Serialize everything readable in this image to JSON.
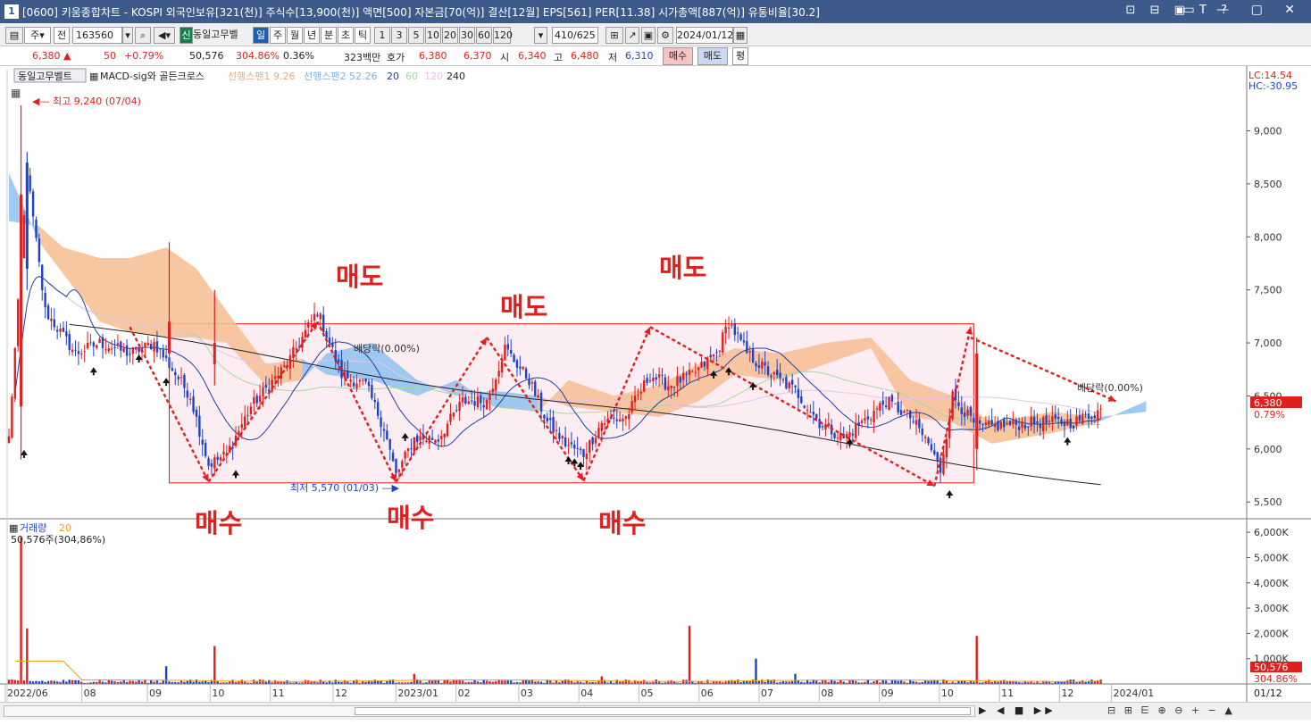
{
  "window": {
    "icon": "1",
    "title": "[0600] 키움종합차트 - KOSPI 외국인보유[321(천)] 주식수[13,900(천)] 액면[500] 자본금[70(억)] 결산[12월] EPS[561] PER[11.38] 시가총액[887(억)] 유통비율[30.2]",
    "tools": "⊡ ⊟ ▣ T ?",
    "controls": "▭ — ▢ ✕"
  },
  "toolbar": {
    "period_main": "주",
    "prev": "전",
    "code": "163560",
    "badge": "신",
    "name": "동일고무벨",
    "periods": [
      "일",
      "주",
      "월",
      "년",
      "분",
      "초",
      "틱"
    ],
    "minutes": [
      "1",
      "3",
      "5",
      "10",
      "20",
      "30",
      "60",
      "120"
    ],
    "count": "410",
    "count_total": "/625",
    "date": "2024/01/12"
  },
  "quote": {
    "price": "6,380",
    "arrow": "▲",
    "change": "50",
    "rate": "+0.79%",
    "volume": "50,576",
    "vol_ratio": "304.86%",
    "turnover": "0.36%",
    "amount": "323백만",
    "hoga_label": "호가",
    "ask": "6,380",
    "bid": "6,370",
    "open_label": "시",
    "open": "6,340",
    "high_label": "고",
    "high": "6,480",
    "low_label": "저",
    "low": "6,310",
    "buy_btn": "매수",
    "sell_btn": "매도",
    "eval_btn": "평"
  },
  "legend": {
    "name": "동일고무벨트",
    "indicator": "MACD-sig와 골든크로스",
    "span1": "선행스팬1 9.26",
    "span2": "선행스팬2 52.26",
    "ma20": "20",
    "ma60": "60",
    "ma120": "120",
    "ma240": "240",
    "lc": "LC:14.54",
    "hc": "HC:-30.95"
  },
  "annotations": {
    "high_mark": "최고 9,240 (07/04)",
    "low_mark": "최저 5,570 (01/03)",
    "dividend1": "배당락(0.00%)",
    "dividend2": "배당락(0.00%)",
    "sell": "매도",
    "buy": "매수"
  },
  "colors": {
    "up": "#e0201f",
    "down": "#1d44c8",
    "cloud_bull": "#f6bd92",
    "cloud_bear": "#8ec1ee",
    "box_fill": "#fcedf3",
    "ma240": "#222222",
    "ma20": "#1f3fa8",
    "vol_ma": "#e8a317"
  },
  "volume_legend": {
    "name": "거래량",
    "period": "20",
    "value": "50,576주(304,86%)"
  },
  "chart_data": {
    "type": "candlestick",
    "price_axis": {
      "ticks": [
        "9,000",
        "8,500",
        "8,000",
        "7,500",
        "7,000",
        "6,500",
        "6,000",
        "5,500"
      ],
      "range": [
        5350,
        9560
      ]
    },
    "volume_axis": {
      "ticks": [
        "6,000K",
        "5,000K",
        "4,000K",
        "3,000K",
        "2,000K",
        "1,000K"
      ],
      "range": [
        0,
        6500
      ]
    },
    "current_price_label": "6,380",
    "current_rate_label": "0.79%",
    "current_volume_label": "50,576",
    "current_volume_rate": "304.86%",
    "x_ticks": [
      "2022/06",
      "08",
      "09",
      "10",
      "11",
      "12",
      "2023/01",
      "02",
      "03",
      "04",
      "05",
      "06",
      "07",
      "08",
      "09",
      "10",
      "11",
      "12",
      "2024/01"
    ],
    "x_end_label": "01/12",
    "anchor_prices": [
      [
        0,
        6100
      ],
      [
        6,
        8600
      ],
      [
        12,
        7300
      ],
      [
        22,
        6900
      ],
      [
        30,
        7000
      ],
      [
        40,
        6900
      ],
      [
        48,
        7000
      ],
      [
        60,
        6500
      ],
      [
        66,
        5850
      ],
      [
        72,
        5950
      ],
      [
        80,
        6400
      ],
      [
        92,
        6800
      ],
      [
        102,
        7300
      ],
      [
        110,
        6700
      ],
      [
        118,
        6600
      ],
      [
        124,
        6200
      ],
      [
        128,
        5750
      ],
      [
        134,
        6100
      ],
      [
        142,
        6100
      ],
      [
        150,
        6450
      ],
      [
        158,
        6450
      ],
      [
        164,
        6950
      ],
      [
        172,
        6650
      ],
      [
        178,
        6250
      ],
      [
        184,
        6050
      ],
      [
        190,
        5950
      ],
      [
        196,
        6250
      ],
      [
        204,
        6300
      ],
      [
        212,
        6700
      ],
      [
        218,
        6600
      ],
      [
        226,
        6700
      ],
      [
        234,
        6900
      ],
      [
        238,
        7200
      ],
      [
        244,
        6900
      ],
      [
        252,
        6700
      ],
      [
        260,
        6550
      ],
      [
        268,
        6250
      ],
      [
        276,
        6100
      ],
      [
        284,
        6300
      ],
      [
        290,
        6450
      ],
      [
        298,
        6300
      ],
      [
        304,
        6050
      ],
      [
        308,
        5800
      ],
      [
        312,
        6500
      ],
      [
        320,
        6200
      ],
      [
        340,
        6250
      ],
      [
        352,
        6250
      ],
      [
        362,
        6380
      ]
    ],
    "volume_spikes": [
      [
        4,
        5800
      ],
      [
        6,
        2200
      ],
      [
        52,
        700
      ],
      [
        68,
        1500
      ],
      [
        134,
        400
      ],
      [
        196,
        300
      ],
      [
        225,
        2300
      ],
      [
        247,
        1000
      ],
      [
        260,
        400
      ],
      [
        320,
        1900
      ]
    ],
    "cloud_anchors": [
      [
        0,
        8150,
        8600
      ],
      [
        10,
        8100,
        7950
      ],
      [
        18,
        7900,
        7650
      ],
      [
        30,
        7800,
        7200
      ],
      [
        40,
        7800,
        7100
      ],
      [
        52,
        7900,
        7050
      ],
      [
        62,
        7700,
        7050
      ],
      [
        72,
        7300,
        7000
      ],
      [
        85,
        6800,
        6600
      ],
      [
        97,
        6850,
        6650
      ],
      [
        105,
        6700,
        6900
      ],
      [
        120,
        6650,
        7000
      ],
      [
        135,
        6500,
        6650
      ],
      [
        148,
        6650,
        6500
      ],
      [
        160,
        6400,
        6550
      ],
      [
        175,
        6350,
        6500
      ],
      [
        185,
        6650,
        6400
      ],
      [
        200,
        6500,
        6350
      ],
      [
        215,
        6600,
        6300
      ],
      [
        228,
        6800,
        6450
      ],
      [
        240,
        6950,
        6700
      ],
      [
        255,
        6900,
        6650
      ],
      [
        270,
        7000,
        6800
      ],
      [
        285,
        7050,
        6950
      ],
      [
        298,
        6650,
        6300
      ],
      [
        312,
        6500,
        6250
      ],
      [
        325,
        6250,
        6050
      ],
      [
        345,
        6350,
        6150
      ],
      [
        360,
        6300,
        6250
      ],
      [
        376,
        6350,
        6450
      ]
    ]
  }
}
